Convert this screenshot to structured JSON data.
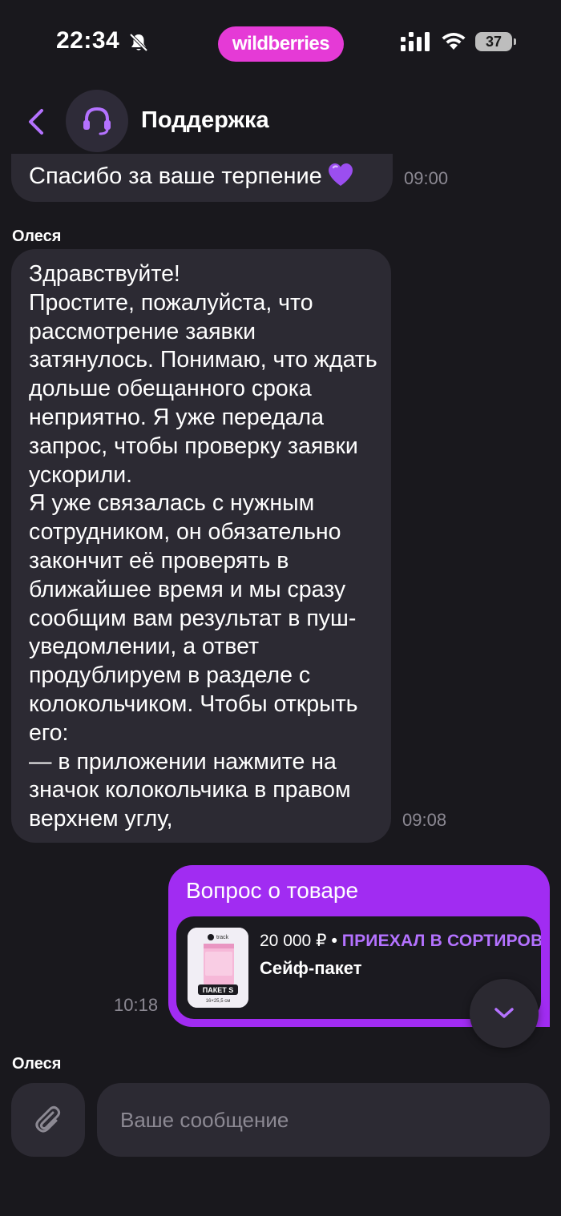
{
  "status_bar": {
    "time": "22:34",
    "app_badge": "wildberries",
    "battery": "37",
    "icons": [
      "bell-slash-icon",
      "signal-icon",
      "wifi-icon",
      "battery-icon"
    ]
  },
  "header": {
    "title": "Поддержка",
    "icons": [
      "chevron-left-icon",
      "headset-icon"
    ]
  },
  "messages": [
    {
      "direction": "incoming",
      "text": "Спасибо за ваше терпение",
      "emoji": "purple-heart",
      "time": "09:00"
    },
    {
      "direction": "incoming",
      "sender": "Олеся",
      "text": "Здравствуйте!\nПростите, пожалуйста, что рассмотрение заявки затянулось. Понимаю, что ждать дольше обещанного срока неприятно. Я уже передала запрос, чтобы проверку заявки ускорили.\nЯ уже связалась с нужным сотрудником, он обязательно закончит её проверять в ближайшее время и мы сразу сообщим вам результат в пуш-уведомлении, а ответ продублируем в разделе с колокольчиком. Чтобы открыть его:\n— в приложении нажмите на значок колокольчика в правом верхнем углу,",
      "time": "09:08"
    },
    {
      "direction": "outgoing",
      "title": "Вопрос о товаре",
      "product": {
        "price": "20 000 ₽",
        "separator": "•",
        "status": "ПРИЕХАЛ В СОРТИРОВ",
        "name": "Сейф-пакет",
        "thumb_brand": "track",
        "thumb_label": "ПАКЕТ S",
        "thumb_size": "16×25,5 см"
      },
      "time": "10:18"
    }
  ],
  "typing_sender": "Олеся",
  "composer": {
    "placeholder": "Ваше сообщение"
  },
  "colors": {
    "background": "#19181d",
    "incoming_bubble": "#2c2a33",
    "outgoing_bubble": "#a12cf2",
    "accent": "#b472ff",
    "badge": "#e53ad6"
  }
}
